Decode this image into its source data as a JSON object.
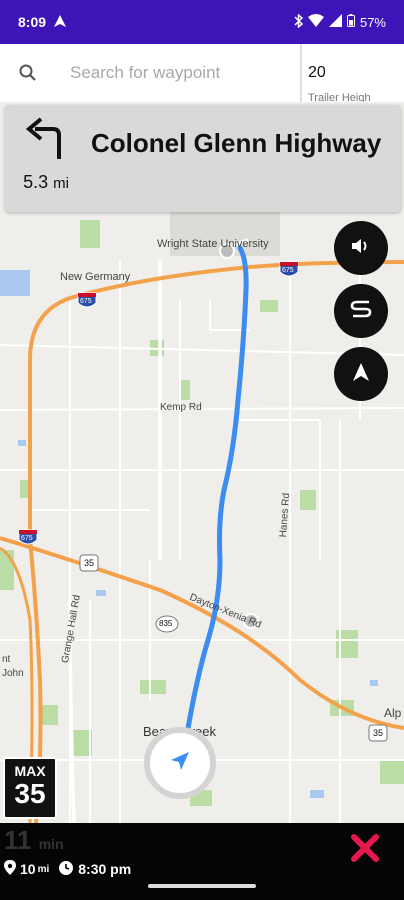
{
  "status_bar": {
    "time": "8:09",
    "battery": "57%"
  },
  "search": {
    "placeholder": "Search for waypoint",
    "side_value": "20",
    "side_sub": "Trailer Heigh"
  },
  "turn": {
    "distance_value": "5.3",
    "distance_unit": "mi",
    "road_name": "Colonel Glenn Highway",
    "direction_icon": "turn-left-arrow-icon"
  },
  "map": {
    "labels": {
      "university": "Wright State University",
      "new_germany": "New Germany",
      "kemp": "Kemp Rd",
      "dayton_xenia": "Dayton-Xenia Rd",
      "grange_hall": "Grange Hall Rd",
      "hanes": "Hanes Rd",
      "beavercreek": "Beavercreek",
      "alp": "Alp",
      "john_1": "nt",
      "john_2": "John"
    },
    "shields": {
      "i675_top": "675",
      "i675_left": "675",
      "i675_right": "675",
      "us35_left": "35",
      "us35_right": "35",
      "r835": "835"
    },
    "colors": {
      "route": "#3d8df0",
      "highway": "#f3a14b",
      "background": "#efeeea",
      "park": "#a8d98f"
    }
  },
  "controls": {
    "sound_icon": "speaker-icon",
    "route_icon": "route-icon",
    "compass_icon": "north-arrow-icon",
    "locate_icon": "navigation-arrow-icon"
  },
  "speed_limit": {
    "label": "MAX",
    "value": "35"
  },
  "bottom": {
    "eta_minutes": "11",
    "eta_minutes_unit": "min",
    "distance": "10",
    "distance_unit": "mi",
    "arrival_time": "8:30 pm",
    "close_color": "#e8194f"
  }
}
